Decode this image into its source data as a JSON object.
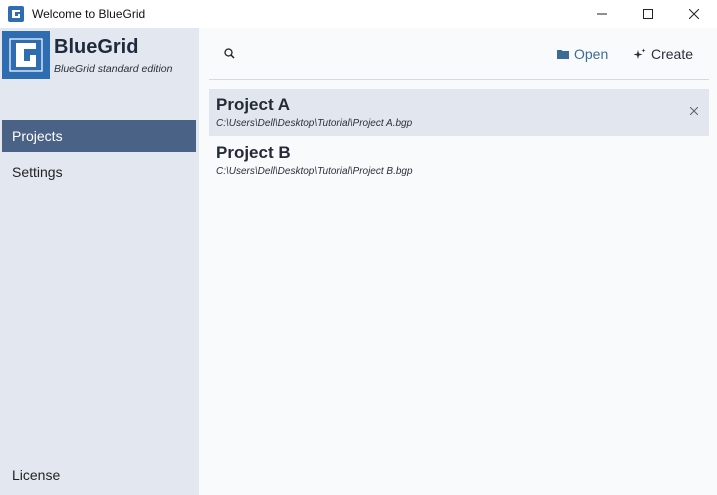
{
  "window": {
    "title": "Welcome to BlueGrid",
    "controls": [
      "minimize-icon",
      "maximize-icon",
      "close-icon"
    ]
  },
  "brand": {
    "name": "BlueGrid",
    "edition": "BlueGrid standard edition",
    "color": "#2f6db3"
  },
  "sidebar": {
    "items": [
      {
        "label": "Projects",
        "active": true
      },
      {
        "label": "Settings",
        "active": false
      }
    ],
    "license": "License",
    "active_color": "#4a6286"
  },
  "toolbar": {
    "search_placeholder": "",
    "open_label": "Open",
    "create_label": "Create",
    "open_color": "#3d6b96"
  },
  "projects": [
    {
      "name": "Project A",
      "path": "C:\\Users\\Dell\\Desktop\\Tutorial\\Project A.bgp",
      "selected": true
    },
    {
      "name": "Project B",
      "path": "C:\\Users\\Dell\\Desktop\\Tutorial\\Project B.bgp",
      "selected": false
    }
  ]
}
